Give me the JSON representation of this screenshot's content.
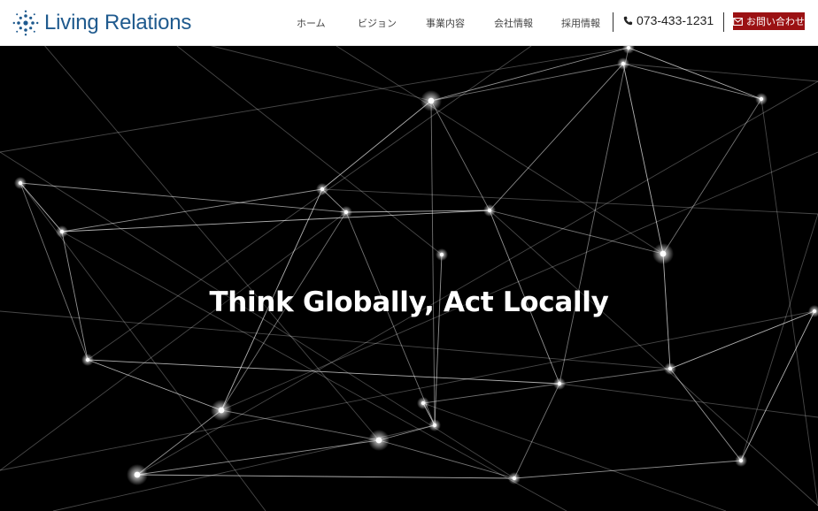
{
  "brand": {
    "name": "Living Relations",
    "accent": "#1f5a8e"
  },
  "nav": {
    "items": [
      {
        "label": "ホーム"
      },
      {
        "label": "ビジョン"
      },
      {
        "label": "事業内容"
      },
      {
        "label": "会社情報"
      },
      {
        "label": "採用情報"
      }
    ],
    "phone": "073-433-1231",
    "contact_label": "お問い合わせ",
    "contact_color": "#9b1113"
  },
  "hero": {
    "headline": "Think Globally, Act Locally",
    "background": "#000000"
  }
}
